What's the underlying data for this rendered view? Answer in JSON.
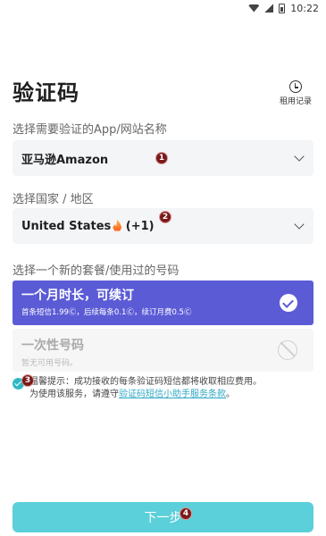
{
  "status_bar": {
    "time": "10:22"
  },
  "header": {
    "title": "验证码",
    "history_label": "租用记录"
  },
  "app_section": {
    "label": "选择需要验证的App/网站名称",
    "value": "亚马逊Amazon",
    "badge": "1"
  },
  "country_section": {
    "label": "选择国家 / 地区",
    "value": "United States",
    "code": "(+1)",
    "badge": "2"
  },
  "plan_section": {
    "label": "选择一个新的套餐/使用过的号码",
    "plans": [
      {
        "title": "一个月时长，可续订",
        "desc": "首条短信1.99Ⓒ，后续每条0.1Ⓒ，续订月费0.5Ⓒ",
        "selected": true
      },
      {
        "title": "一次性号码",
        "desc": "暂无可用号码。",
        "selected": false
      }
    ]
  },
  "notice": {
    "badge": "3",
    "line1": "温馨提示：成功接收的每条验证码短信都将收取相应费用。",
    "line2_prefix": "为使用该服务，请遵守",
    "link": "验证码短信小助手服务条款",
    "line2_suffix": "。"
  },
  "next_button": {
    "label": "下一步",
    "badge": "4"
  },
  "colors": {
    "primary": "#5b5bd6",
    "accent": "#5bd0da",
    "link": "#2ea8c4"
  }
}
